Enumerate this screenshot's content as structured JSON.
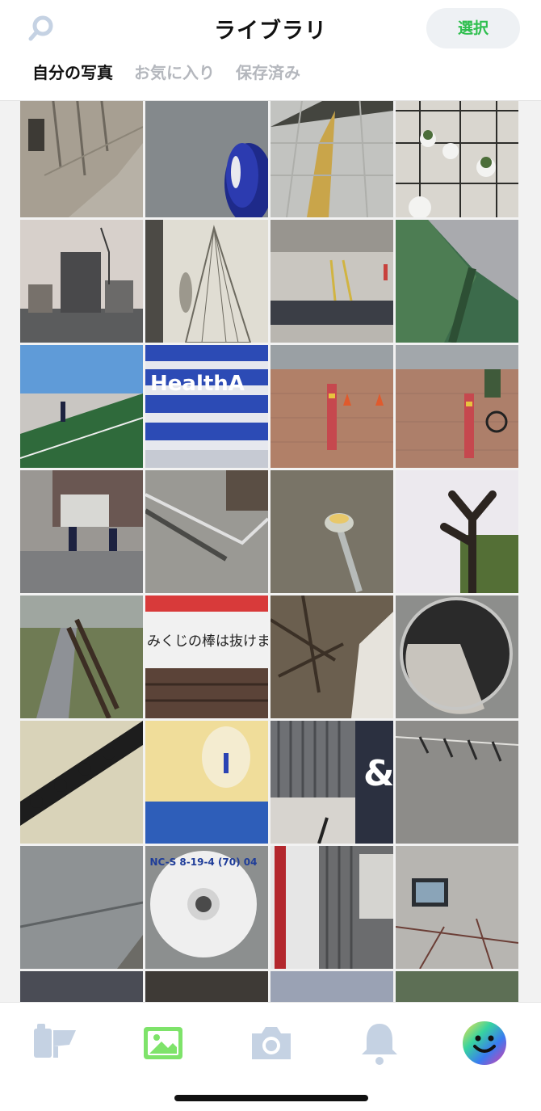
{
  "header": {
    "title": "ライブラリ",
    "select_label": "選択",
    "search_icon": "search-icon"
  },
  "tabs": [
    {
      "label": "自分の写真",
      "active": true
    },
    {
      "label": "お気に入り",
      "active": false
    },
    {
      "label": "保存済み",
      "active": false
    }
  ],
  "colors": {
    "accent_green": "#2fbf4f",
    "inactive_tab": "#b4b7bd",
    "tab_icon": "#c5d2e3",
    "select_bg": "#eef1f4"
  },
  "tab_bar": {
    "items": [
      {
        "icon": "film-icon",
        "active": false
      },
      {
        "icon": "photo-library-icon",
        "active": true
      },
      {
        "icon": "camera-icon",
        "active": false
      },
      {
        "icon": "bell-icon",
        "active": false
      },
      {
        "icon": "avatar-smiley-icon",
        "active": false
      }
    ]
  },
  "photos": [
    {
      "subject": "weathered wooden wall"
    },
    {
      "subject": "asphalt with blue sneaker"
    },
    {
      "subject": "tiled pavement with tactile strip"
    },
    {
      "subject": "potted plants on frame"
    },
    {
      "subject": "city skyline with crane"
    },
    {
      "subject": "shadow and string tree on wall"
    },
    {
      "subject": "plaza with railing"
    },
    {
      "subject": "green track and striped wall"
    },
    {
      "subject": "green track with runner"
    },
    {
      "subject": "stairs with text"
    },
    {
      "subject": "brick sidewalk with bollard"
    },
    {
      "subject": "brick sidewalk with cyclist"
    },
    {
      "subject": "building entrance with people"
    },
    {
      "subject": "metal railing shadow"
    },
    {
      "subject": "garden light on ground"
    },
    {
      "subject": "pruned tree branch"
    },
    {
      "subject": "park path with benches"
    },
    {
      "subject": "banner sign"
    },
    {
      "subject": "tree roots and stone"
    },
    {
      "subject": "round hole with tree"
    },
    {
      "subject": "roof tiles detail"
    },
    {
      "subject": "yellow fixture with blue"
    },
    {
      "subject": "shutter with ampersand sign"
    },
    {
      "subject": "wall with hooks"
    },
    {
      "subject": "asphalt with crack"
    },
    {
      "subject": "round marker plate"
    },
    {
      "subject": "building stairs"
    },
    {
      "subject": "wall with window and ivy"
    }
  ],
  "photo_texts": {
    "stairs": "HealthA",
    "banner": "みくじの棒は抜けま",
    "marker": "NC-S 8-19-4 (70) 04",
    "ampersand": "&"
  }
}
